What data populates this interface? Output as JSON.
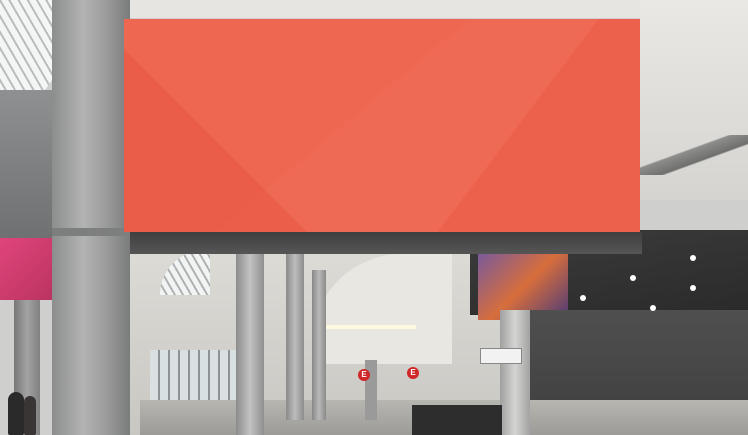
{
  "scene": {
    "description_colors": {
      "banner": "#ef6a55",
      "pillar": "#a6a7a6",
      "ceiling_beam": "#474747",
      "pink_screen": "#d93e72"
    }
  },
  "signs": {
    "exit_left": "E",
    "exit_right": "E"
  }
}
